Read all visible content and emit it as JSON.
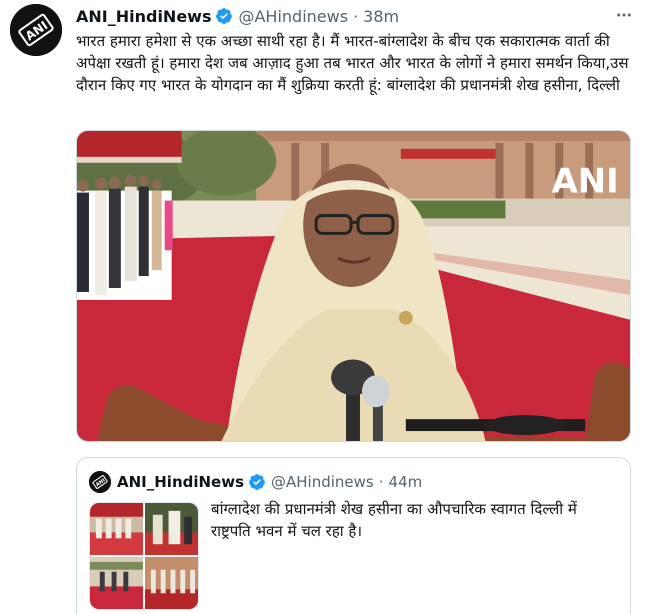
{
  "tweet": {
    "author": {
      "display_name": "ANI_HindiNews",
      "handle": "@AHindinews",
      "verified": true,
      "avatar_text": "ANI"
    },
    "time": "38m",
    "separator": "·",
    "text": "भारत हमारा हमेशा से एक अच्छा साथी रहा है। मैं भारत-बांग्लादेश के बीच एक सकारात्मक वार्ता की अपेक्षा रखती हूं। हमारा देश जब आज़ाद हुआ तब भारत और भारत के लोगों ने हमारा समर्थन किया,उस दौरान किए गए भारत के योगदान का मैं शुक्रिया करती हूं: बांग्लादेश की प्रधानमंत्री शेख हसीना, दिल्ली",
    "media": {
      "watermark": "ANI"
    },
    "more_icon": "ellipsis-icon"
  },
  "quote": {
    "author": {
      "display_name": "ANI_HindiNews",
      "handle": "@AHindinews",
      "verified": true,
      "avatar_text": "ANI"
    },
    "time": "44m",
    "separator": "·",
    "text": "बांग्लादेश की प्रधानमंत्री शेख हसीना का औपचारिक स्वागत दिल्ली में राष्ट्रपति भवन में चल रहा है।"
  },
  "colors": {
    "accent": "#1d9bf0",
    "secondary_text": "#536471",
    "border": "#cfd9de"
  }
}
